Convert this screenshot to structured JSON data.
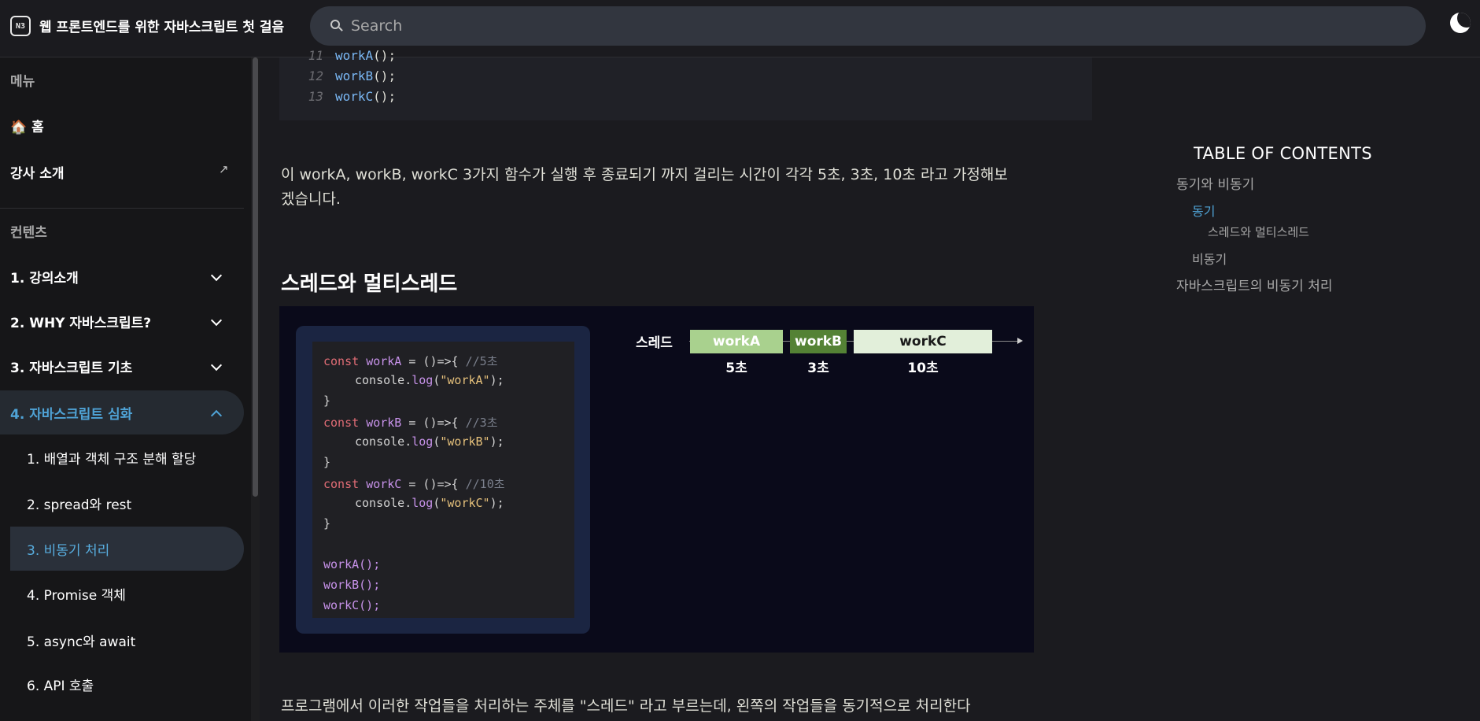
{
  "header": {
    "logo_text": "N3",
    "title": "웹 프론트엔드를 위한 자바스크립트 첫 걸음",
    "search_placeholder": "Search"
  },
  "sidebar": {
    "menu_group": "메뉴",
    "home": "🏠 홈",
    "instructor": "강사 소개",
    "content_group": "컨텐츠",
    "sections": [
      {
        "label": "1. 강의소개"
      },
      {
        "label": "2. WHY 자바스크립트?"
      },
      {
        "label": "3. 자바스크립트 기초"
      },
      {
        "label": "4. 자바스크립트 심화"
      }
    ],
    "subitems": [
      {
        "label": "1. 배열과 객체 구조 분해 할당"
      },
      {
        "label": "2. spread와 rest"
      },
      {
        "label": "3. 비동기 처리"
      },
      {
        "label": "4. Promise 객체"
      },
      {
        "label": "5. async와 await"
      },
      {
        "label": "6. API 호출"
      }
    ]
  },
  "code_block": {
    "lines": [
      {
        "num": "11",
        "fn": "workA",
        "rest": "();"
      },
      {
        "num": "12",
        "fn": "workB",
        "rest": "();"
      },
      {
        "num": "13",
        "fn": "workC",
        "rest": "();"
      }
    ]
  },
  "main": {
    "para1_line1": "이 workA, workB, workC 3가지 함수가 실행 후 종료되기 까지 걸리는 시간이 각각 5초, 3초, 10초 라고 가정해보",
    "para1_line2": "겠습니다.",
    "heading": "스레드와 멀티스레드",
    "para2": "프로그램에서 이러한 작업들을 처리하는 주체를 \"스레드\" 라고 부르는데, 왼쪽의 작업들을 동기적으로 처리한다"
  },
  "figure": {
    "code": {
      "kw": "const",
      "arrow": " = ()=>{ ",
      "console_pre": "console.",
      "log": "log",
      "paren_open": "(",
      "paren_close": ");",
      "close_brace": "}",
      "funcs": [
        {
          "name": "workA",
          "comment": "//5초",
          "string": "\"workA\""
        },
        {
          "name": "workB",
          "comment": "//3초",
          "string": "\"workB\""
        },
        {
          "name": "workC",
          "comment": "//10초",
          "string": "\"workC\""
        }
      ],
      "calls": [
        "workA();",
        "workB();",
        "workC();"
      ]
    },
    "thread_label": "스레드",
    "tasks": [
      {
        "name": "workA",
        "duration": "5초"
      },
      {
        "name": "workB",
        "duration": "3초"
      },
      {
        "name": "workC",
        "duration": "10초"
      }
    ]
  },
  "toc": {
    "title": "TABLE OF CONTENTS",
    "items": [
      {
        "label": "동기와 비동기"
      },
      {
        "label": "동기"
      },
      {
        "label": "스레드와 멀티스레드"
      },
      {
        "label": "비동기"
      },
      {
        "label": "자바스크립트의 비동기 처리"
      }
    ]
  },
  "colors": {
    "accent": "#4fa3d6",
    "bar_workA": "#a9d18e",
    "bar_workB": "#548235",
    "bar_workC": "#e2efda"
  }
}
